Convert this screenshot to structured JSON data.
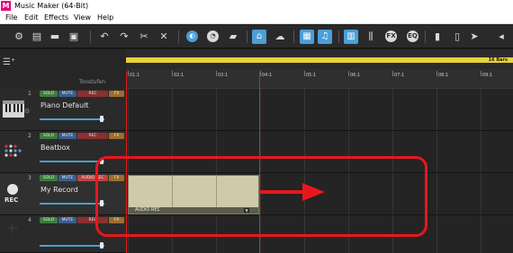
{
  "window": {
    "title": "Music Maker (64-Bit)",
    "logo_letter": "M"
  },
  "menu": [
    "File",
    "Edit",
    "Effects",
    "View",
    "Help"
  ],
  "toolbar": {
    "icons": [
      "settings-icon",
      "new-file-icon",
      "open-folder-icon",
      "save-icon",
      "undo-icon",
      "redo-icon",
      "cut-icon",
      "delete-icon",
      "snap-icon",
      "knob-icon",
      "folder-icon",
      "store-icon",
      "cloud-icon",
      "media-pool-icon",
      "music-note-icon",
      "keyboard-icon",
      "mixer-icon",
      "fx-icon",
      "eq-icon",
      "levels-icon",
      "meter-icon",
      "cursor-icon",
      "more-icon"
    ]
  },
  "header": {
    "tonstufen": "Tonstufen",
    "bars_label": "16 Bars"
  },
  "ruler": [
    "01:1",
    "02:1",
    "03:1",
    "04:1",
    "05:1",
    "06:1",
    "07:1",
    "08:1",
    "09:1"
  ],
  "tracks": [
    {
      "number": "1",
      "name": "Piano Default",
      "solo": "SOLO",
      "mute": "MUTE",
      "rec": "REC",
      "fx": "FX",
      "icon": "piano-icon",
      "volume": 0.95
    },
    {
      "number": "2",
      "name": "Beatbox",
      "solo": "SOLO",
      "mute": "MUTE",
      "rec": "REC",
      "fx": "FX",
      "icon": "drum-pads-icon",
      "volume": 0.95
    },
    {
      "number": "3",
      "name": "My Record",
      "solo": "SOLO",
      "mute": "MUTE",
      "rec": "AUDIO REC",
      "fx": "FX",
      "icon": "record-icon",
      "icon_label": "REC",
      "volume": 0.95
    },
    {
      "number": "4",
      "name": "",
      "solo": "SOLO",
      "mute": "MUTE",
      "rec": "REC",
      "fx": "FX",
      "icon": "add-icon",
      "volume": 0.95
    }
  ],
  "clip": {
    "label": "AUDIO REC"
  },
  "colors": {
    "accent": "#4a9fd8",
    "annotation": "#e8171e",
    "timeline": "#e8d23a"
  }
}
